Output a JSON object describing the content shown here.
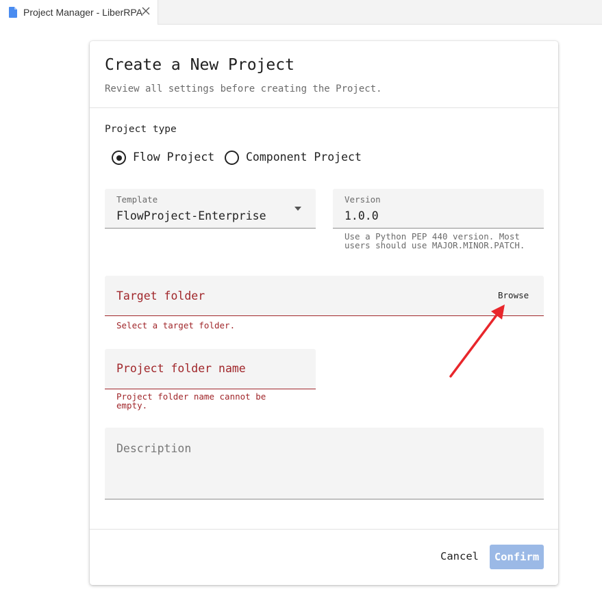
{
  "tab": {
    "title": "Project Manager - LiberRPA",
    "icon": "file-icon",
    "close_icon": "close-icon"
  },
  "dialog": {
    "title": "Create a New Project",
    "subtitle": "Review all settings before creating the Project.",
    "project_type": {
      "label": "Project type",
      "options": [
        {
          "label": "Flow Project",
          "selected": true
        },
        {
          "label": "Component Project",
          "selected": false
        }
      ]
    },
    "template": {
      "label": "Template",
      "value": "FlowProject-Enterprise"
    },
    "version": {
      "label": "Version",
      "value": "1.0.0",
      "hint": "Use a Python PEP 440 version. Most users should use MAJOR.MINOR.PATCH."
    },
    "target_folder": {
      "label": "Target folder",
      "browse_label": "Browse",
      "error": "Select a target folder."
    },
    "project_folder_name": {
      "label": "Project folder name",
      "error": "Project folder name cannot be empty."
    },
    "description": {
      "placeholder": "Description"
    },
    "buttons": {
      "cancel": "Cancel",
      "confirm": "Confirm"
    }
  },
  "colors": {
    "error": "#a0262a",
    "confirm_disabled": "#9bb9e6",
    "annotation_arrow": "#e8262b",
    "field_bg": "#f4f4f4"
  }
}
